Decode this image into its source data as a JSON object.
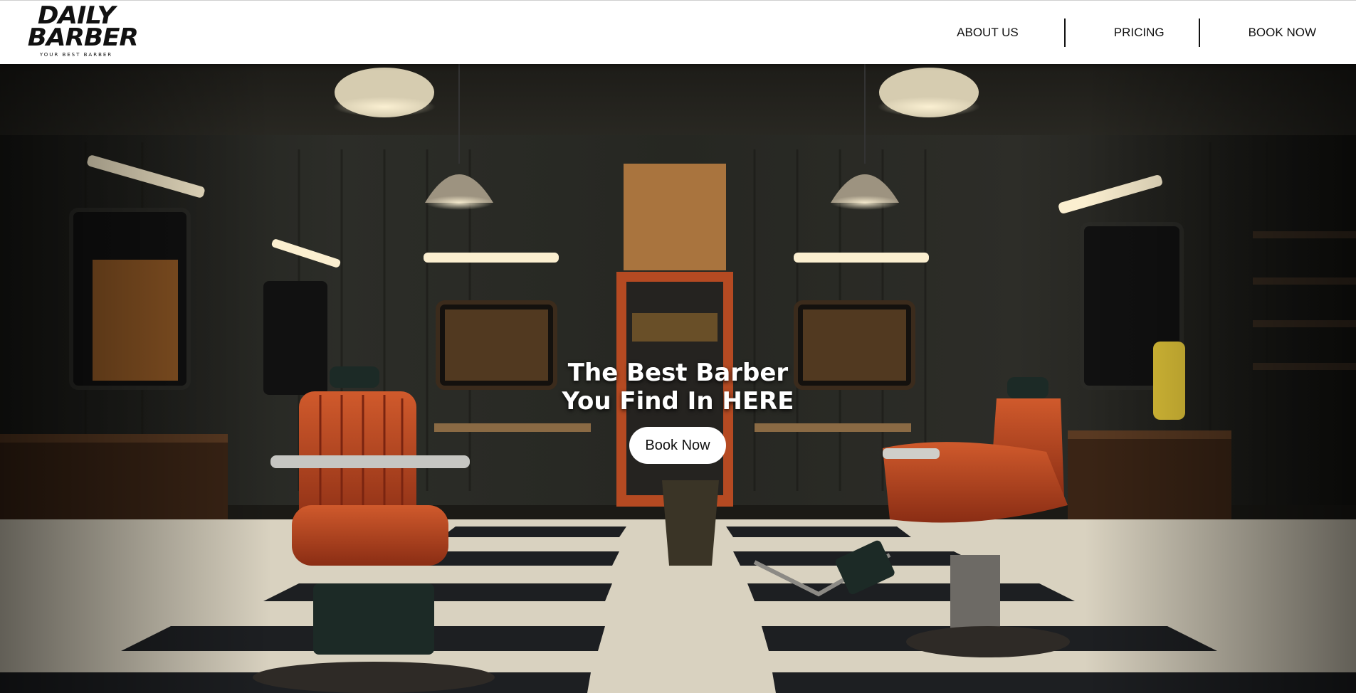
{
  "brand": {
    "name_line1": "DAILY",
    "name_line2": "BARBER",
    "tagline": "YOUR BEST BARBER"
  },
  "nav": {
    "items": [
      {
        "label": "ABOUT US"
      },
      {
        "label": "PRICING"
      },
      {
        "label": "BOOK NOW"
      }
    ]
  },
  "hero": {
    "title_line1": "The Best Barber",
    "title_line2": "You Find In HERE",
    "cta_label": "Book Now",
    "background_description_icon": "barbershop-interior-photo"
  },
  "colors": {
    "header_bg": "#ffffff",
    "text_dark": "#111111",
    "hero_text": "#ffffff",
    "button_bg": "#ffffff",
    "chair_leather": "#b8431e",
    "floor_dark": "#1d1f22",
    "floor_light": "#d9d2c0"
  }
}
